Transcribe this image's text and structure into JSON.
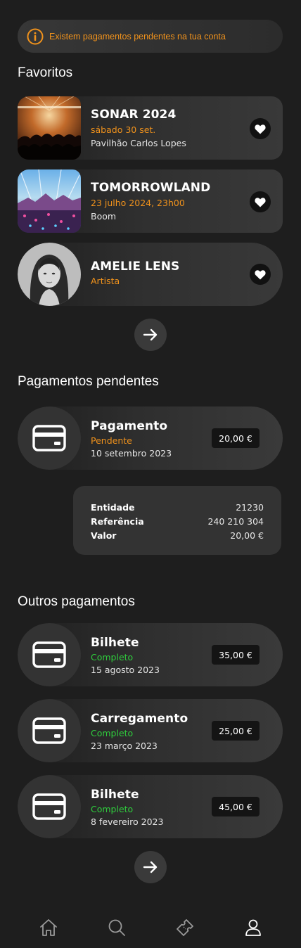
{
  "alert": {
    "text": "Existem pagamentos pendentes na tua conta",
    "icon": "info-icon"
  },
  "favorites": {
    "title": "Favoritos",
    "items": [
      {
        "title": "SONAR 2024",
        "subtitle": "sábado 30 set.",
        "meta": "Pavilhão Carlos Lopes",
        "thumb": "concert-crowd-image"
      },
      {
        "title": "TOMORROWLAND",
        "subtitle": "23 julho 2024, 23h00",
        "meta": "Boom",
        "thumb": "festival-stage-image"
      },
      {
        "title": "AMELIE LENS",
        "subtitle": "Artista",
        "meta": "",
        "thumb": "artist-portrait-image"
      }
    ]
  },
  "pending": {
    "title": "Pagamentos pendentes",
    "item": {
      "title": "Pagamento",
      "status": "Pendente",
      "date": "10 setembro 2023",
      "amount": "20,00 €"
    },
    "details": {
      "entidade_label": "Entidade",
      "entidade_value": "21230",
      "referencia_label": "Referência",
      "referencia_value": "240 210 304",
      "valor_label": "Valor",
      "valor_value": "20,00 €"
    }
  },
  "others": {
    "title": "Outros pagamentos",
    "items": [
      {
        "title": "Bilhete",
        "status": "Completo",
        "date": "15 agosto 2023",
        "amount": "35,00 €"
      },
      {
        "title": "Carregamento",
        "status": "Completo",
        "date": "23 março 2023",
        "amount": "25,00 €"
      },
      {
        "title": "Bilhete",
        "status": "Completo",
        "date": "8 fevereiro 2023",
        "amount": "45,00 €"
      }
    ]
  },
  "nav": {
    "items": [
      "home-icon",
      "search-icon",
      "ticket-icon",
      "profile-icon"
    ]
  },
  "colors": {
    "background": "#1e1e1e",
    "accent": "#f0921c",
    "success": "#2fcc3d"
  }
}
